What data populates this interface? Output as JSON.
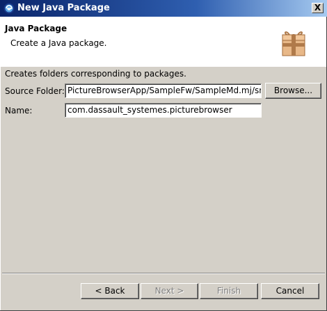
{
  "window": {
    "title": "New Java Package",
    "close_label": "X"
  },
  "banner": {
    "title": "Java Package",
    "description": "Create a Java package."
  },
  "form": {
    "intro": "Creates folders corresponding to packages.",
    "source_folder_label": "Source Folder:",
    "source_folder_value": "PictureBrowserApp/SampleFw/SampleMd.mj/src",
    "browse_label": "Browse...",
    "name_label": "Name:",
    "name_value": "com.dassault_systemes.picturebrowser"
  },
  "footer": {
    "back_label": "< Back",
    "next_label": "Next >",
    "finish_label": "Finish",
    "cancel_label": "Cancel"
  },
  "colors": {
    "titlebar_start": "#0a246a",
    "titlebar_end": "#a6caf0",
    "dialog_bg": "#d4d0c8",
    "banner_bg": "#ffffff",
    "disabled_text": "#808080"
  },
  "icons": {
    "title": "eclipse-icon",
    "banner": "package-box-icon",
    "close": "close-icon"
  }
}
